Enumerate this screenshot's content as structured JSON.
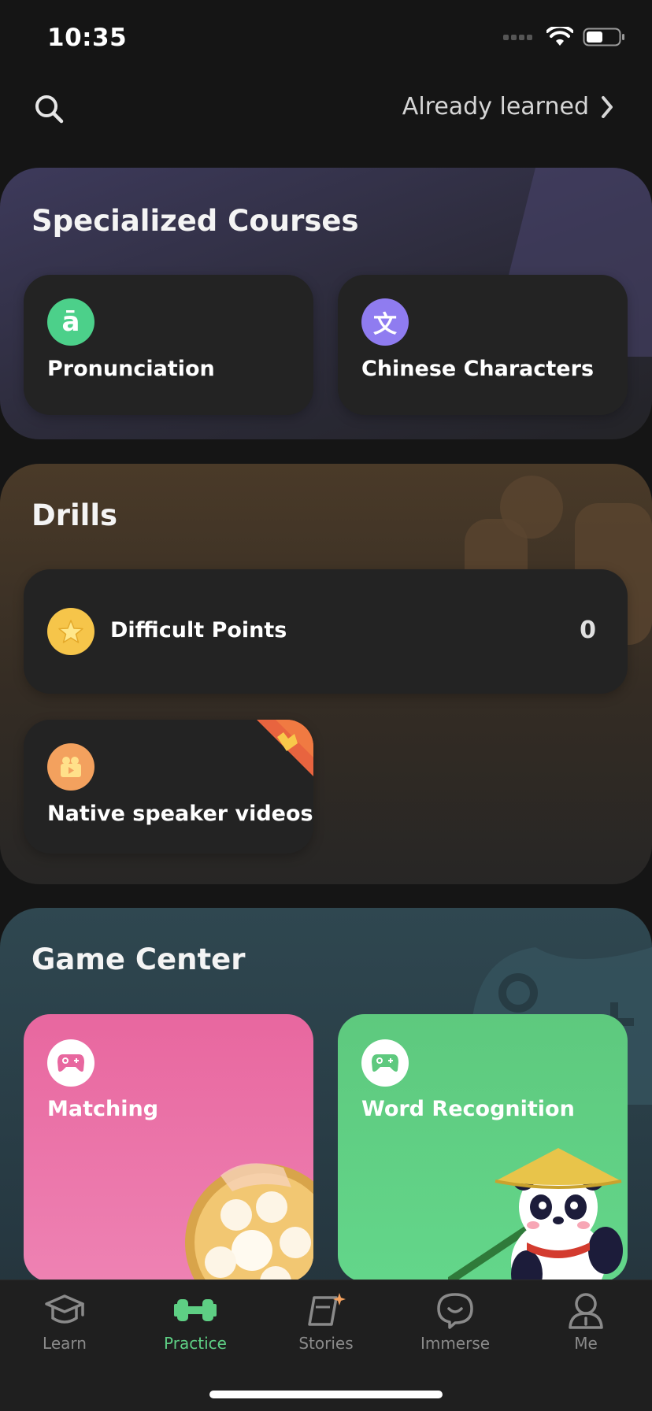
{
  "status_bar": {
    "time": "10:35"
  },
  "top_bar": {
    "already_learned": "Already learned"
  },
  "specialized_courses": {
    "title": "Specialized Courses",
    "items": [
      {
        "label": "Pronunciation",
        "icon": "pronunciation-icon",
        "glyph": "ā",
        "color": "#4cd08a"
      },
      {
        "label": "Chinese Characters",
        "icon": "chinese-character-icon",
        "glyph": "文",
        "color": "#8f7cf0"
      }
    ]
  },
  "drills": {
    "title": "Drills",
    "difficult_points": {
      "label": "Difficult Points",
      "count": "0",
      "icon": "star-icon",
      "color": "#f6c54a"
    },
    "native_videos": {
      "label": "Native speaker videos",
      "icon": "video-icon",
      "color": "#f3a15e",
      "badge_icon": "crown-badge-icon"
    }
  },
  "game_center": {
    "title": "Game Center",
    "games": [
      {
        "label": "Matching",
        "icon": "gamepad-icon",
        "color": "#ec6ba6"
      },
      {
        "label": "Word Recognition",
        "icon": "gamepad-icon",
        "color": "#5dcf82"
      }
    ]
  },
  "tab_bar": {
    "tabs": [
      {
        "label": "Learn",
        "icon": "graduation-cap-icon",
        "active": false
      },
      {
        "label": "Practice",
        "icon": "dumbbell-icon",
        "active": true
      },
      {
        "label": "Stories",
        "icon": "book-icon",
        "active": false
      },
      {
        "label": "Immerse",
        "icon": "chat-bubble-icon",
        "active": false
      },
      {
        "label": "Me",
        "icon": "person-icon",
        "active": false
      }
    ]
  }
}
